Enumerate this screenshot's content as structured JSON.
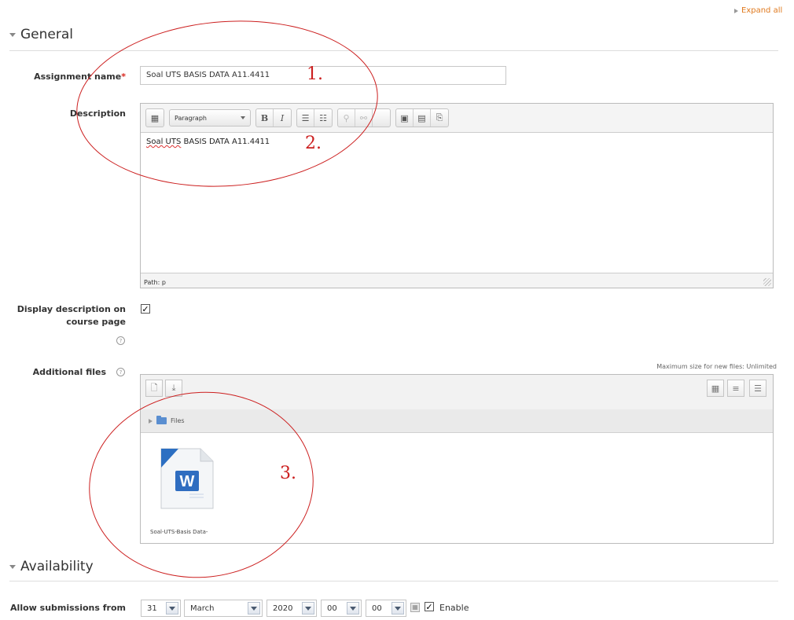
{
  "expand_all": "Expand all",
  "sections": {
    "general": "General",
    "availability": "Availability"
  },
  "fields": {
    "assignment_name": {
      "label": "Assignment name",
      "required_mark": "*",
      "value": "Soal UTS BASIS DATA A11.4411"
    },
    "description": {
      "label": "Description",
      "format_select": "Paragraph",
      "content_spell": "Soal UTS",
      "content_rest": " BASIS DATA A11.4411",
      "path": "Path: p"
    },
    "display_description": {
      "label_line1": "Display description on",
      "label_line2": "course page",
      "checked": true
    },
    "additional_files": {
      "label": "Additional files",
      "max_size_note": "Maximum size for new files: Unlimited",
      "folder": "Files",
      "file_name": "Soal-UTS-Basis Data-"
    },
    "allow_submissions_from": {
      "label": "Allow submissions from",
      "day": "31",
      "month": "March",
      "year": "2020",
      "hour": "00",
      "minute": "00",
      "enable_label": "Enable",
      "enabled": true
    }
  },
  "annotations": [
    "1.",
    "2.",
    "3."
  ],
  "colors": {
    "annotation": "#cc1f1f",
    "required": "#d9261c",
    "link": "#e07a1f"
  }
}
